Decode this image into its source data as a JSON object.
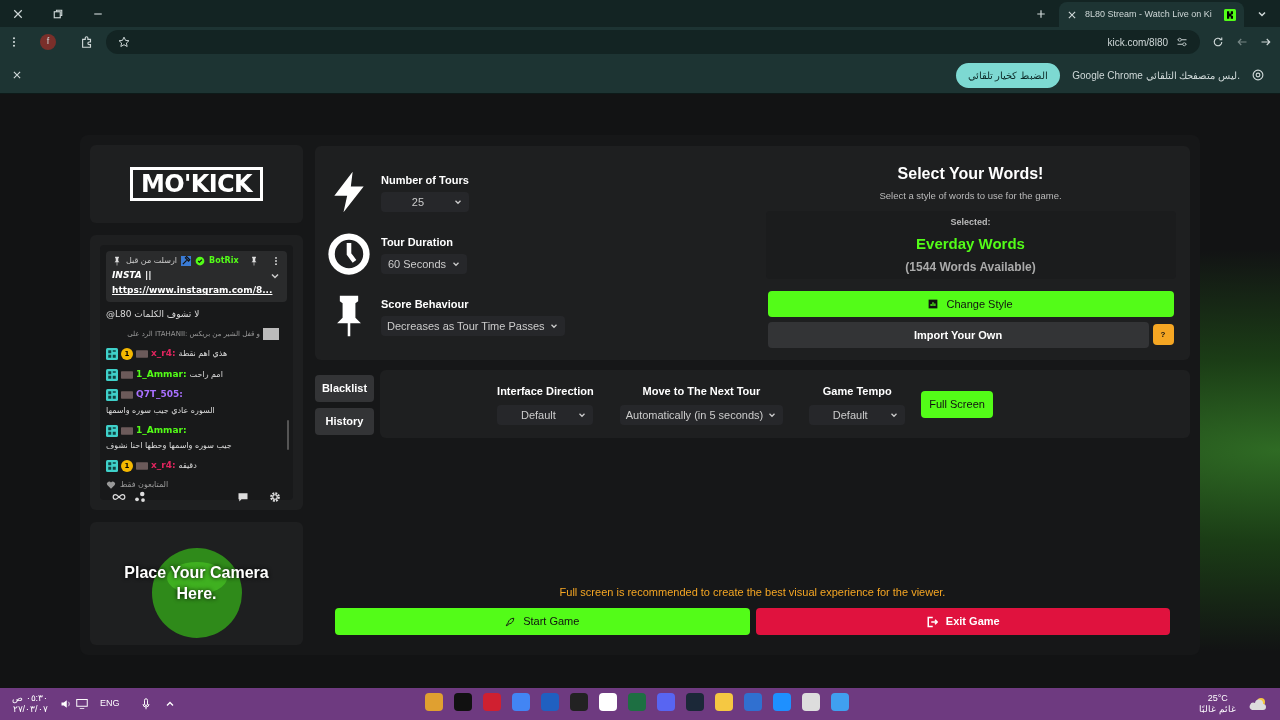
{
  "browser": {
    "tab_title": "8L80 Stream - Watch Live on Ki",
    "address": "kick.com/8l80",
    "infobar_message": "Google Chrome ليس متصفحك التلقائي.",
    "infobar_button": "الضبط كخيار تلقائي",
    "profile_initial": "f"
  },
  "logo": "MO'KICK",
  "chat": {
    "pinned": {
      "label": "ارسلت من قبل",
      "author": "BotRix",
      "lines": [
        "INSTA ||",
        "https://www.instagram.com/8..."
      ]
    },
    "messages": [
      {
        "kind": "plain",
        "text": "@L80 لا تشوف الكلمات"
      },
      {
        "kind": "reply",
        "text": "الرد على ITAHANII: و قفل الشير من بريكس"
      },
      {
        "kind": "user",
        "badge": "1",
        "user": "x_r4:",
        "color": "#e0245e",
        "text": "هذي اهم نقطة"
      },
      {
        "kind": "user",
        "user": "1_Ammar:",
        "color": "#53fc18",
        "text": "امم راحت"
      },
      {
        "kind": "user",
        "user": "Q7T_505:",
        "color": "#a970ff",
        "text": "السوره عادي جيب سوره واسمها"
      },
      {
        "kind": "user",
        "user": "1_Ammar:",
        "color": "#53fc18",
        "text": "جيب سوره واسمها وحطها احنا نشوف"
      },
      {
        "kind": "user",
        "badge": "1",
        "user": "x_r4:",
        "color": "#e0245e",
        "text": "دقيقه"
      }
    ],
    "mode": "المتابعون فقط"
  },
  "camera": "Place Your Camera Here.",
  "settings": [
    {
      "kind": "bolt",
      "label": "Number of Tours",
      "value": "25"
    },
    {
      "kind": "clock",
      "label": "Tour Duration",
      "value": "60 Seconds"
    },
    {
      "kind": "pin",
      "label": "Score Behaviour",
      "value": "Decreases as Tour Time Passes"
    }
  ],
  "words": {
    "title": "Select Your Words!",
    "subtitle": "Select a style of words to use for the game.",
    "selected_label": "Selected:",
    "selected": "Everday Words",
    "available": "(1544 Words Available)",
    "change_button": "Change Style",
    "import_button": "Import Your Own",
    "help_button": "?"
  },
  "side_buttons": [
    "Blacklist",
    "History"
  ],
  "options": [
    {
      "label": "Interface Direction",
      "value": "Default"
    },
    {
      "label": "Move to The Next Tour",
      "value": "Automatically (in 5 seconds)"
    },
    {
      "label": "Game Tempo",
      "value": "Default"
    }
  ],
  "fullscreen_button": "Full Screen",
  "notice": "Full screen is recommended to create the best visual experience for the viewer.",
  "start_button": "Start Game",
  "exit_button": "Exit Game",
  "taskbar": {
    "time": "٠٥:٣٠ ص",
    "date": "٢٧/٠٣/٠٧",
    "language": "ENG",
    "temperature": "25°C",
    "weather": "غائم غالبًا"
  }
}
